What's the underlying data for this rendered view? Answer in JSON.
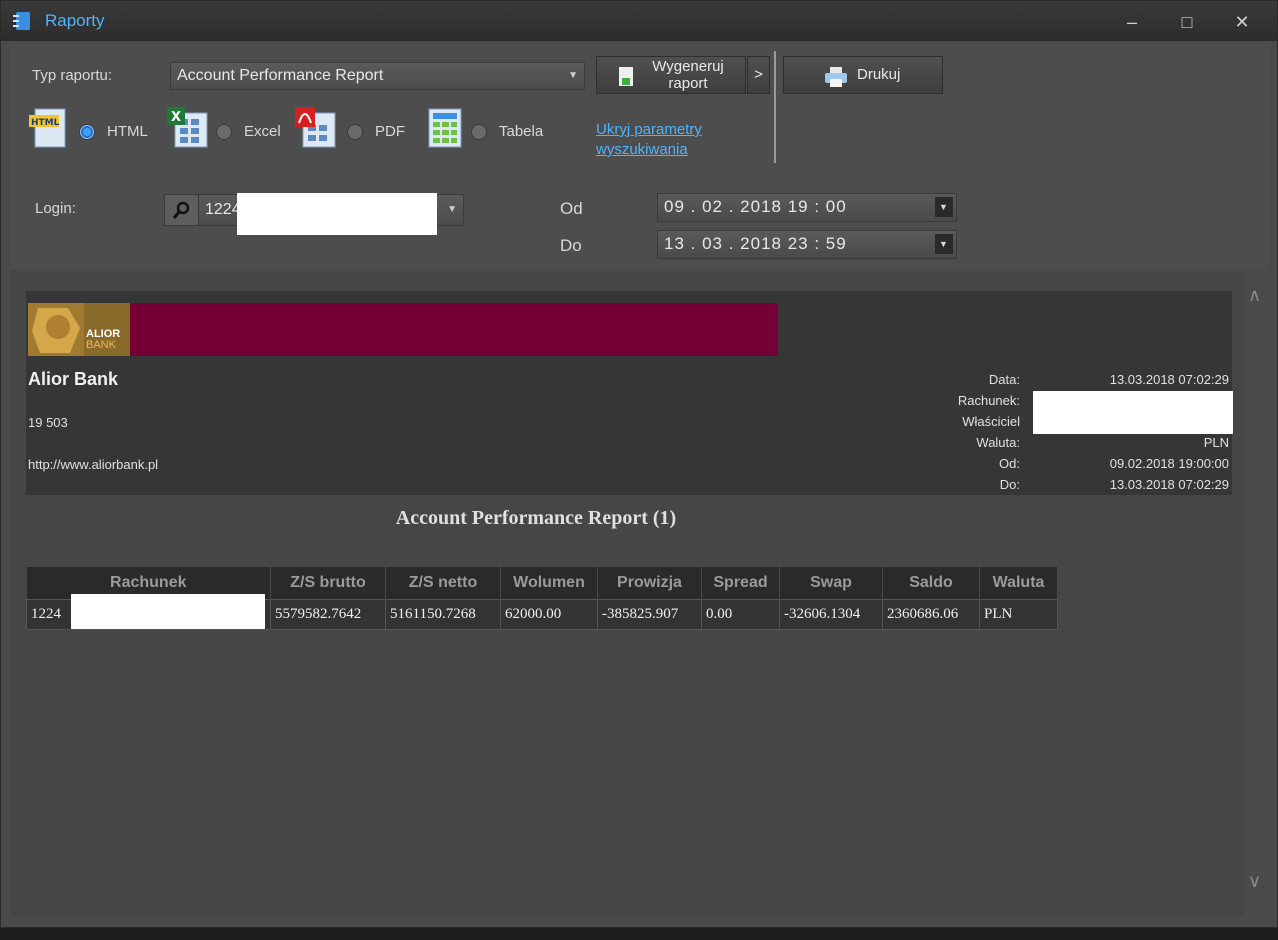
{
  "window": {
    "title": "Raporty",
    "minimize": "–",
    "maximize": "□",
    "close": "✕"
  },
  "params": {
    "report_type_label": "Typ raportu:",
    "report_type_value": "Account Performance Report",
    "generate_label_1": "Wygeneruj",
    "generate_label_2": "raport",
    "generate_more": ">",
    "print_label": "Drukuj",
    "formats": [
      {
        "label": "HTML",
        "selected": true,
        "icon": "html-file-icon"
      },
      {
        "label": "Excel",
        "selected": false,
        "icon": "excel-file-icon"
      },
      {
        "label": "PDF",
        "selected": false,
        "icon": "pdf-file-icon"
      },
      {
        "label": "Tabela",
        "selected": false,
        "icon": "table-file-icon"
      }
    ],
    "hide_link_1": "Ukryj parametry",
    "hide_link_2": "wyszukiwania",
    "login_label": "Login:",
    "login_value": "1224",
    "from_label": "Od",
    "to_label": "Do",
    "from_value": "09 . 02 . 2018   19 : 00",
    "to_value": "13 . 03 . 2018   23 : 59"
  },
  "report": {
    "logo_text_1": "ALIOR",
    "logo_text_2": "BANK",
    "bank_name": "Alior Bank",
    "bank_code": "19 503",
    "bank_url": "http://www.aliorbank.pl",
    "meta": [
      {
        "key": "Data:",
        "value": "13.03.2018 07:02:29"
      },
      {
        "key": "Rachunek:",
        "value": ""
      },
      {
        "key": "Właściciel",
        "value": ""
      },
      {
        "key": "Waluta:",
        "value": "PLN"
      },
      {
        "key": "Od:",
        "value": "09.02.2018 19:00:00"
      },
      {
        "key": "Do:",
        "value": "13.03.2018 07:02:29"
      }
    ],
    "title": "Account Performance Report (1)",
    "columns": [
      "Rachunek",
      "Z/S brutto",
      "Z/S netto",
      "Wolumen",
      "Prowizja",
      "Spread",
      "Swap",
      "Saldo",
      "Waluta"
    ],
    "rows": [
      [
        "1224",
        "5579582.7642",
        "5161150.7268",
        "62000.00",
        "-385825.907",
        "0.00",
        "-32606.1304",
        "2360686.06",
        "PLN"
      ]
    ]
  },
  "scroll": {
    "up": "∧",
    "down": "∨"
  },
  "colors": {
    "accent": "#4fb3ff",
    "brand": "#750036"
  }
}
